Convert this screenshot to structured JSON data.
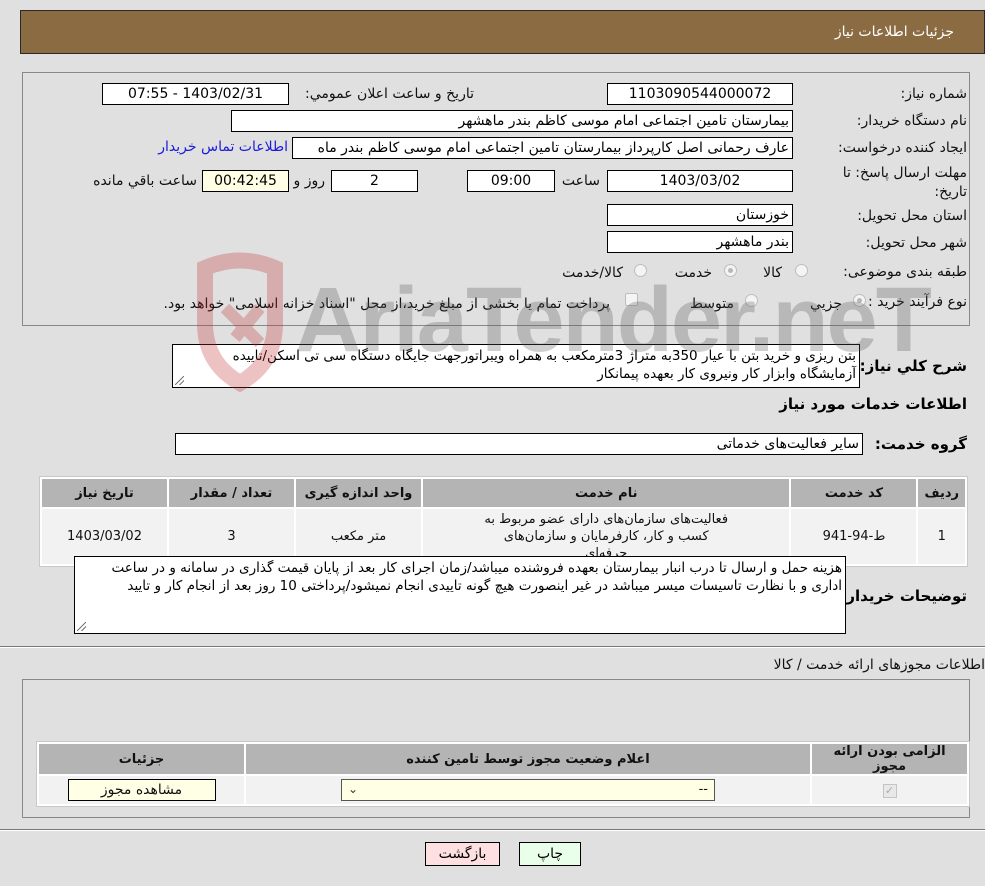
{
  "header": {
    "title": "جزئیات اطلاعات نیاز"
  },
  "details": {
    "need_number": {
      "label": "شماره نیاز:",
      "value": "1103090544000072"
    },
    "announce": {
      "label": "تاریخ و ساعت اعلان عمومي:",
      "value": "1403/02/31 - 07:55"
    },
    "buyer_org": {
      "label": "نام دستگاه خریدار:",
      "value": "بیمارستان تامین اجتماعی امام موسی کاظم بندر ماهشهر"
    },
    "creator": {
      "label": "ایجاد کننده درخواست:",
      "value": "عارف رحمانی اصل کارپرداز بیمارستان تامین اجتماعی امام موسی کاظم بندر ماه"
    },
    "contact_link": "اطلاعات تماس خریدار",
    "deadline": {
      "label": "مهلت ارسال پاسخ: تا تاریخ:",
      "date": "1403/03/02",
      "time_label": "ساعت",
      "time": "09:00",
      "days": "2",
      "days_label": "روز و",
      "remaining": "00:42:45",
      "remaining_label": "ساعت باقي مانده"
    },
    "province": {
      "label": "استان محل تحویل:",
      "value": "خوزستان"
    },
    "city": {
      "label": "شهر محل تحویل:",
      "value": "بندر ماهشهر"
    },
    "category": {
      "label": "طبقه بندی موضوعی:",
      "options": [
        "کالا",
        "خدمت",
        "کالا/خدمت"
      ],
      "selected": "خدمت"
    },
    "purchase_type": {
      "label": "نوع فرآیند خرید :",
      "options": [
        "جزيي",
        "متوسط"
      ],
      "selected": "جزيي",
      "payment_note": "پرداخت تمام یا بخشی از مبلغ خرید،از محل \"اسناد خزانه اسلامی\" خواهد بود."
    }
  },
  "description": {
    "label": "شرح کلي نياز:",
    "text": "بتن ریزی و خرید بتن با عیار 350به متراژ 3مترمکعب به همراه ویبراتورجهت جایگاه دستگاه سی تی اسکن/تاییده آزمایشگاه وابزار کار ونیروی کار بعهده پیمانکار"
  },
  "services": {
    "section_title": "اطلاعات خدمات مورد نیاز",
    "group_label": "گروه خدمت:",
    "group_value": "سایر فعالیت‌های خدماتی",
    "columns": [
      "ردیف",
      "کد خدمت",
      "نام خدمت",
      "واحد اندازه گیری",
      "تعداد / مقدار",
      "تاریخ نیاز"
    ],
    "rows": [
      {
        "row": "1",
        "code": "ط-94-941",
        "name": "فعالیت‌های سازمان‌های دارای عضو مربوط به کسب و کار، کارفرمایان و سازمان‌های حرفه‌ای",
        "unit": "متر مکعب",
        "qty": "3",
        "date": "1403/03/02"
      }
    ]
  },
  "buyer_notes": {
    "label": "توضیحات خریدار:",
    "text": "هزینه حمل و ارسال تا درب انبار بیمارستان بعهده فروشنده میباشد/زمان اجرای کار بعد از پایان قیمت گذاری در سامانه و در ساعت اداری و با نظارت تاسیسات میسر میباشد در غیر اینصورت هیچ گونه تاییدی انجام نمیشود/پرداختی 10 روز بعد از انجام کار و تایید"
  },
  "permits": {
    "section_title": "اطلاعات مجوزهای ارائه خدمت / کالا",
    "columns": [
      "الزامی بودن ارائه مجوز",
      "اعلام وضعیت مجوز توسط تامین کننده",
      "جزئیات"
    ],
    "rows": [
      {
        "required": true,
        "status_value": "--",
        "details_button": "مشاهده مجوز"
      }
    ]
  },
  "footer": {
    "print_button": "چاپ",
    "back_button": "بازگشت"
  },
  "watermark": {
    "text": "AriaTender.neT"
  }
}
